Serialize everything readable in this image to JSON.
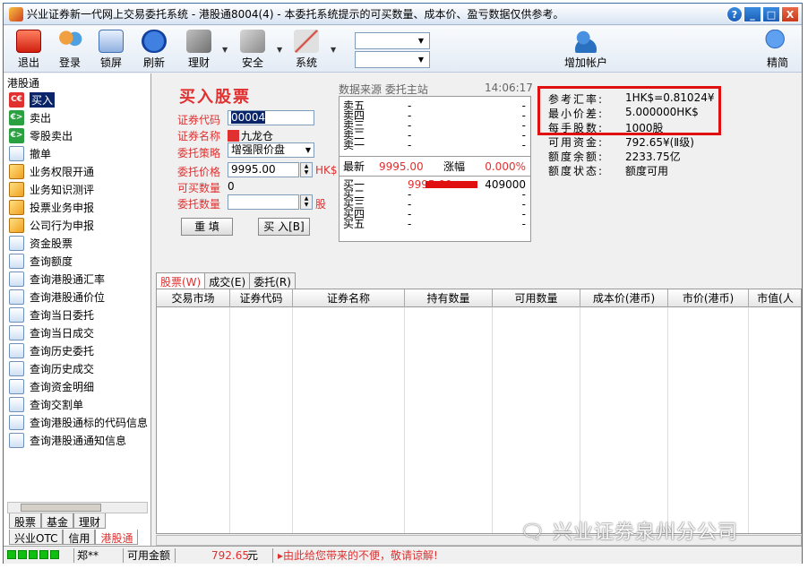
{
  "window": {
    "title": "兴业证券新一代网上交易委托系统 - 港股通8004(4) - 本委托系统提示的可买数量、成本价、盈亏数据仅供参考。",
    "help_label": "?",
    "min_label": "_",
    "max_label": "□",
    "close_label": "X"
  },
  "toolbar": {
    "items": [
      {
        "label": "退出",
        "icon": "exit-icon"
      },
      {
        "label": "登录",
        "icon": "users-icon"
      },
      {
        "label": "锁屏",
        "icon": "lock-screen-icon"
      },
      {
        "label": "刷新",
        "icon": "refresh-icon"
      },
      {
        "label": "理财",
        "icon": "finance-icon"
      },
      {
        "label": "安全",
        "icon": "security-icon"
      },
      {
        "label": "系统",
        "icon": "tools-icon"
      }
    ],
    "select1": "",
    "select2": "",
    "add_account": "增加帐户",
    "simple": "精简"
  },
  "sidebar": {
    "title": "港股通",
    "items": [
      {
        "label": "买入",
        "icon": "buy-icon",
        "kind": "buy",
        "badge": "C€"
      },
      {
        "label": "卖出",
        "icon": "sell-icon",
        "kind": "sell",
        "badge": "€>"
      },
      {
        "label": "零股卖出",
        "icon": "sell-icon",
        "kind": "sell",
        "badge": "€>"
      },
      {
        "label": "撤单",
        "icon": "document-icon",
        "kind": "doc"
      },
      {
        "label": "业务权限开通",
        "icon": "pen-icon",
        "kind": "pen"
      },
      {
        "label": "业务知识测评",
        "icon": "pen-icon",
        "kind": "pen"
      },
      {
        "label": "投票业务申报",
        "icon": "pen-icon",
        "kind": "pen"
      },
      {
        "label": "公司行为申报",
        "icon": "pen-icon",
        "kind": "pen"
      },
      {
        "label": "资金股票",
        "icon": "document-icon",
        "kind": "doc"
      },
      {
        "label": "查询额度",
        "icon": "document-icon",
        "kind": "doc"
      },
      {
        "label": "查询港股通汇率",
        "icon": "document-icon",
        "kind": "doc"
      },
      {
        "label": "查询港股通价位",
        "icon": "document-icon",
        "kind": "doc"
      },
      {
        "label": "查询当日委托",
        "icon": "document-icon",
        "kind": "doc"
      },
      {
        "label": "查询当日成交",
        "icon": "document-icon",
        "kind": "doc"
      },
      {
        "label": "查询历史委托",
        "icon": "document-icon",
        "kind": "doc"
      },
      {
        "label": "查询历史成交",
        "icon": "document-icon",
        "kind": "doc"
      },
      {
        "label": "查询资金明细",
        "icon": "document-icon",
        "kind": "doc"
      },
      {
        "label": "查询交割单",
        "icon": "document-icon",
        "kind": "doc"
      },
      {
        "label": "查询港股通标的代码信息",
        "icon": "document-icon",
        "kind": "doc"
      },
      {
        "label": "查询港股通通知信息",
        "icon": "document-icon",
        "kind": "doc"
      }
    ],
    "tabs_row1": [
      "股票",
      "基金",
      "理财"
    ],
    "tabs_row2": [
      "兴业OTC",
      "信用",
      "港股通"
    ]
  },
  "order": {
    "title": "买入股票",
    "code_label": "证券代码",
    "code_value": "00004",
    "name_label": "证券名称",
    "name_value": "九龙仓",
    "strategy_label": "委托策略",
    "strategy_value": "增强限价盘",
    "price_label": "委托价格",
    "price_value": "9995.00",
    "price_unit": "HK$",
    "max_label": "可买数量",
    "max_value": "0",
    "qty_label": "委托数量",
    "qty_value": "",
    "qty_unit": "股",
    "reset_button": "重 填",
    "buy_button": "买 入[B]"
  },
  "quote": {
    "header": "数据来源 委托主站",
    "time": "14:06:17",
    "asks": [
      {
        "label": "卖五",
        "price": "-",
        "vol": "-"
      },
      {
        "label": "卖四",
        "price": "-",
        "vol": "-"
      },
      {
        "label": "卖三",
        "price": "-",
        "vol": "-"
      },
      {
        "label": "卖二",
        "price": "-",
        "vol": "-"
      },
      {
        "label": "卖一",
        "price": "-",
        "vol": "-"
      }
    ],
    "last_label": "最新",
    "last_price": "9995.00",
    "change_label": "涨幅",
    "change_value": "0.000%",
    "bids": [
      {
        "label": "买一",
        "price": "9995.00",
        "vol": "409000"
      },
      {
        "label": "买二",
        "price": "-",
        "vol": "-"
      },
      {
        "label": "买三",
        "price": "-",
        "vol": "-"
      },
      {
        "label": "买四",
        "price": "-",
        "vol": "-"
      },
      {
        "label": "买五",
        "price": "-",
        "vol": "-"
      }
    ]
  },
  "info": [
    {
      "key": "参考汇率:",
      "value": "1HK$=0.81024¥"
    },
    {
      "key": "最小价差:",
      "value": "5.000000HK$"
    },
    {
      "key": "每手股数:",
      "value": "1000股"
    },
    {
      "key": "可用资金:",
      "value": "792.65¥(Ⅱ级)"
    },
    {
      "key": "额度余额:",
      "value": "2233.75亿"
    },
    {
      "key": "额度状态:",
      "value": "额度可用"
    }
  ],
  "grid": {
    "tabs": [
      "股票(W)",
      "成交(E)",
      "委托(R)"
    ],
    "columns": [
      "交易市场",
      "证券代码",
      "证券名称",
      "持有数量",
      "可用数量",
      "成本价(港币)",
      "市价(港币)",
      "市值(人"
    ]
  },
  "watermark": "兴业证券泉州分公司",
  "status": {
    "user": "郑**",
    "avail_label": "可用金额",
    "avail_value": "792.65",
    "avail_unit": "元",
    "notice": "由此给您带来的不便，敬请谅解!"
  },
  "colors": {
    "accent_red": "#e03030",
    "title_blue": "#1c5fb8",
    "selection": "#0a246a"
  }
}
